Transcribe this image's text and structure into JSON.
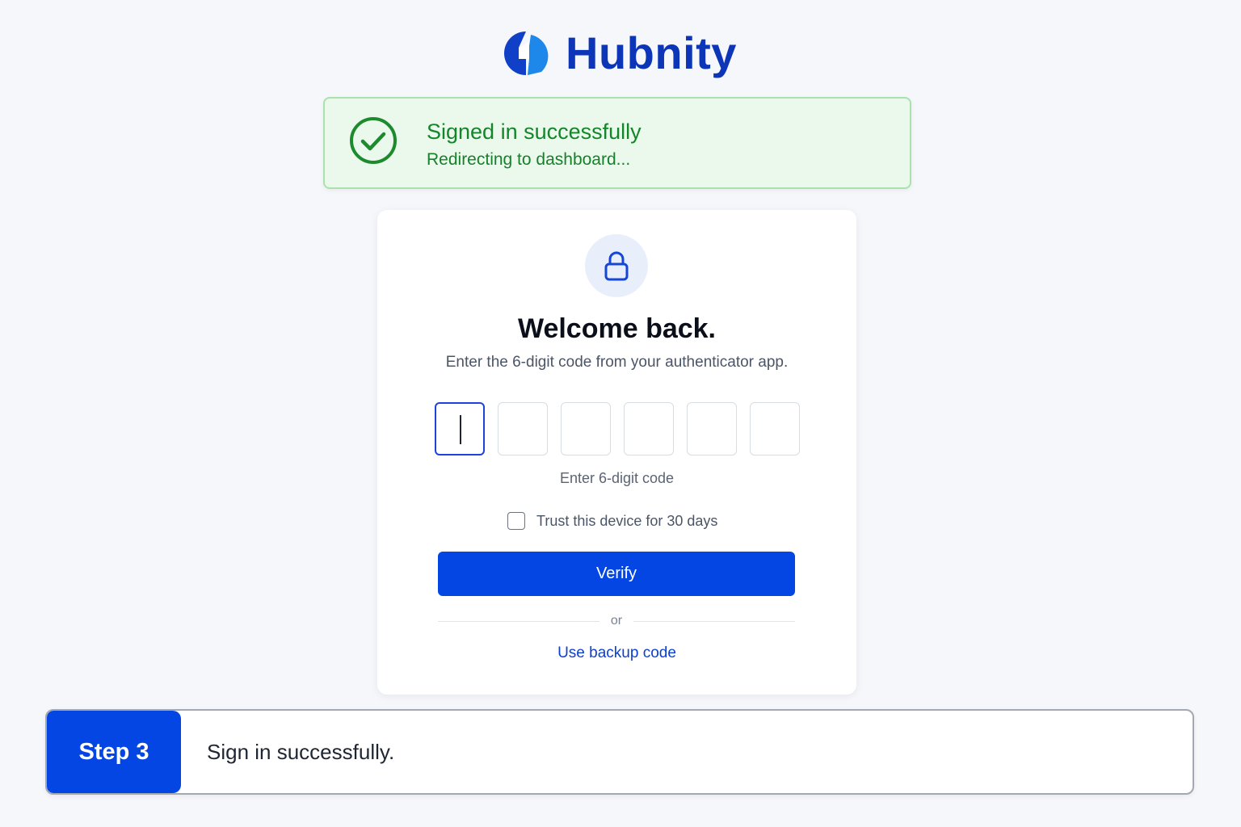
{
  "brand": {
    "name": "Hubnity",
    "logo_icon": "hubnity-logo-icon",
    "color": "#0d35b8"
  },
  "toast": {
    "icon": "check-circle-icon",
    "title": "Signed in successfully",
    "subtitle": "Redirecting to dashboard...",
    "color": "#14862a"
  },
  "card": {
    "icon": "lock-icon",
    "title": "Welcome back.",
    "subtitle": "Enter the 6-digit code from your authenticator app.",
    "code": {
      "digits": [
        "",
        "",
        "",
        "",
        "",
        ""
      ],
      "active_index": 0,
      "hint": "Enter 6-digit code"
    },
    "trust_device": {
      "label": "Trust this device for 30 days",
      "checked": false
    },
    "verify_label": "Verify",
    "divider_label": "or",
    "backup_link": "Use backup code",
    "accent": "#0446e4"
  },
  "step": {
    "badge": "Step 3",
    "text": "Sign in successfully."
  }
}
